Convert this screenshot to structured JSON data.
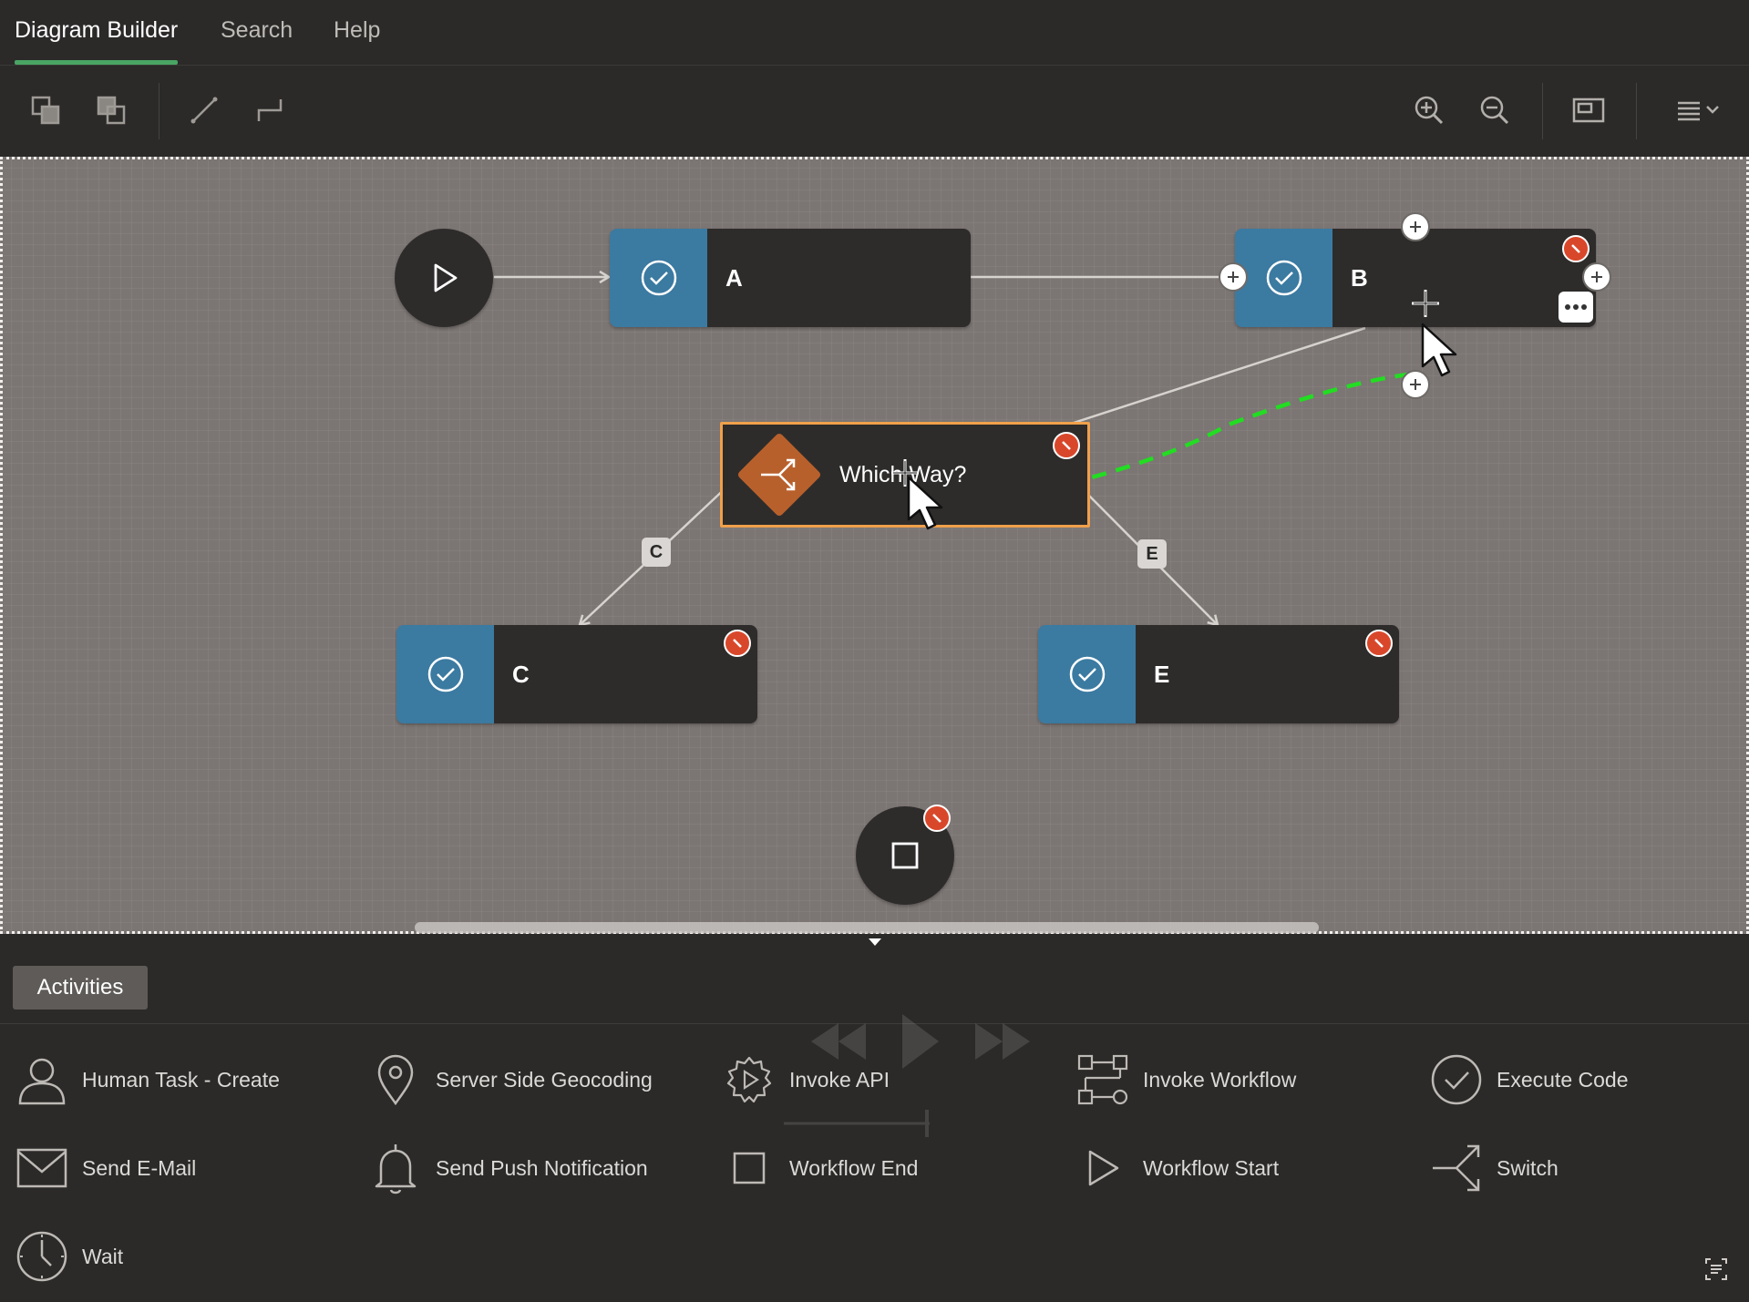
{
  "tabs": [
    {
      "label": "Diagram Builder",
      "active": true
    },
    {
      "label": "Search",
      "active": false
    },
    {
      "label": "Help",
      "active": false
    }
  ],
  "toolbar": {
    "left_icons": [
      "bring-forward-icon",
      "send-backward-icon",
      "straight-connector-icon",
      "elbow-connector-icon"
    ],
    "right_icons": [
      "zoom-in-icon",
      "zoom-out-icon",
      "fit-to-window-icon",
      "menu-icon"
    ]
  },
  "diagram": {
    "nodes": {
      "a": {
        "label": "A"
      },
      "b": {
        "label": "B"
      },
      "switch": {
        "label": "Which Way?"
      },
      "c": {
        "label": "C"
      },
      "e": {
        "label": "E"
      }
    },
    "edge_labels": {
      "c": "C",
      "e": "E"
    }
  },
  "panel": {
    "tab_label": "Activities",
    "activities": [
      {
        "label": "Human Task - Create",
        "icon": "person-icon"
      },
      {
        "label": "Server Side Geocoding",
        "icon": "map-pin-icon"
      },
      {
        "label": "Invoke API",
        "icon": "gear-play-icon"
      },
      {
        "label": "Invoke Workflow",
        "icon": "workflow-icon"
      },
      {
        "label": "Execute Code",
        "icon": "check-circle-icon"
      },
      {
        "label": "Send E-Mail",
        "icon": "envelope-icon"
      },
      {
        "label": "Send Push Notification",
        "icon": "bell-icon"
      },
      {
        "label": "Workflow End",
        "icon": "square-icon"
      },
      {
        "label": "Workflow Start",
        "icon": "play-icon"
      },
      {
        "label": "Switch",
        "icon": "switch-icon"
      },
      {
        "label": "Wait",
        "icon": "clock-icon"
      }
    ]
  },
  "colors": {
    "accent": "#4aa564",
    "task_strip": "#3b7aa1",
    "switch_diamond": "#b8602c",
    "selection": "#f0a04b",
    "delete": "#d9472b",
    "drag_connector": "#22dd22"
  }
}
